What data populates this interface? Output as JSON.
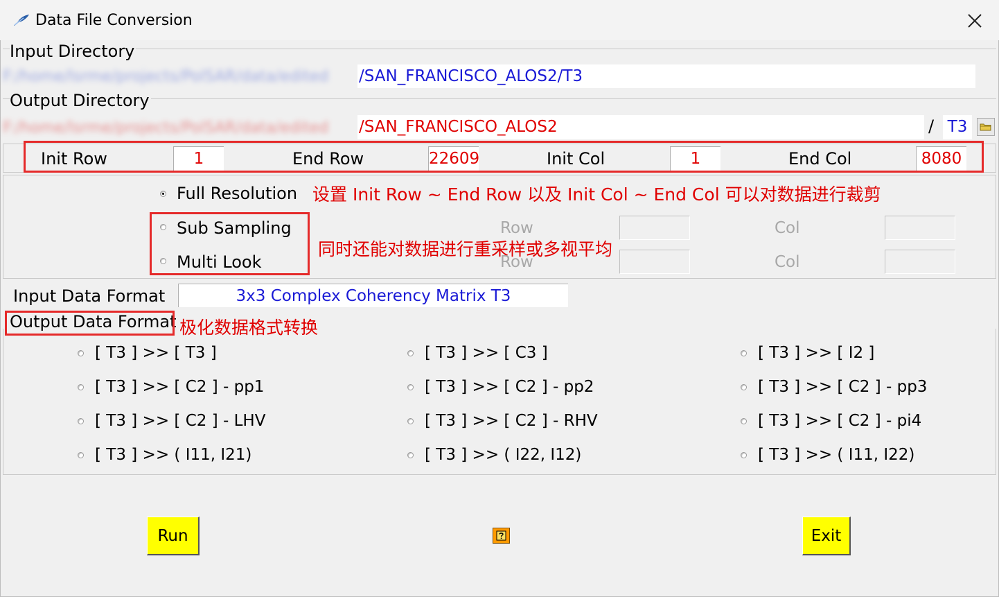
{
  "window": {
    "title": "Data File Conversion"
  },
  "input_dir": {
    "label": "Input Directory",
    "prefix": "F:/home/lsrme/projects/PolSAR/data/edited",
    "value": "/SAN_FRANCISCO_ALOS2/T3"
  },
  "output_dir": {
    "label": "Output Directory",
    "prefix": "F:/home/lsrme/projects/PolSAR/data/edited",
    "value": "/SAN_FRANCISCO_ALOS2",
    "separator": "/",
    "subdir": "T3"
  },
  "crop": {
    "init_row_label": "Init Row",
    "init_row": "1",
    "end_row_label": "End Row",
    "end_row": "22609",
    "init_col_label": "Init Col",
    "init_col": "1",
    "end_col_label": "End Col",
    "end_col": "8080"
  },
  "resolution": {
    "full": "Full Resolution",
    "sub": "Sub Sampling",
    "multi": "Multi Look",
    "row_label": "Row",
    "col_label": "Col",
    "selected": "full"
  },
  "annotations": {
    "crop_note": "设置 Init Row ~ End Row 以及 Init Col ~ End Col 可以对数据进行裁剪",
    "resample_note": "同时还能对数据进行重采样或多视平均",
    "format_note": "极化数据格式转换"
  },
  "input_format": {
    "label": "Input Data Format",
    "value": "3x3 Complex Coherency Matrix T3"
  },
  "output_format": {
    "label": "Output Data Format",
    "options": [
      "[ T3 ] >> [ T3 ]",
      "[ T3 ] >> [ C3 ]",
      "[ T3 ] >> [ I2 ]",
      "[ T3 ] >> [ C2 ] - pp1",
      "[ T3 ] >> [ C2 ] - pp2",
      "[ T3 ] >> [ C2 ] - pp3",
      "[ T3 ] >> [ C2 ] - LHV",
      "[ T3 ] >> [ C2 ] - RHV",
      "[ T3 ] >> [ C2 ] - pi4",
      "[ T3 ] >> ( I11, I21)",
      "[ T3 ] >> ( I22, I12)",
      "[ T3 ] >> ( I11, I22)"
    ]
  },
  "buttons": {
    "run": "Run",
    "exit": "Exit",
    "help_icon": "help-icon"
  },
  "colors": {
    "annotation_red": "#e00000",
    "run_exit_bg": "#ffff00",
    "path_blue": "#1a1ad6",
    "value_red": "#e00000"
  }
}
